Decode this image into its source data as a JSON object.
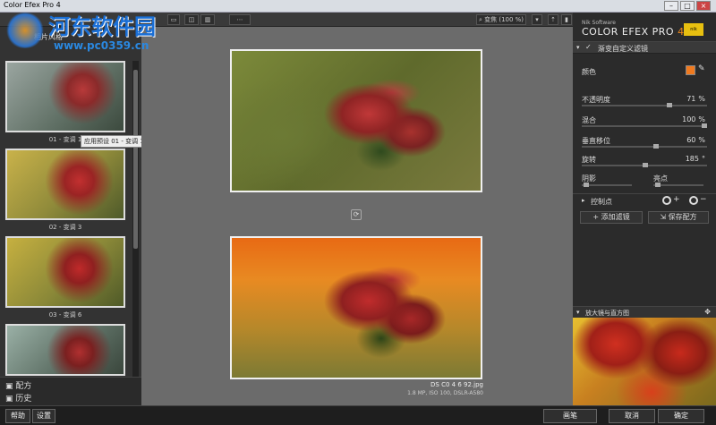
{
  "window": {
    "title": "Color Efex Pro 4"
  },
  "toolbar": {
    "zoom_label": "变焦 (100 %)"
  },
  "left": {
    "header": "相片风格",
    "presets": [
      {
        "label": "01 - 变调 1"
      },
      {
        "label": "02 - 变调 3"
      },
      {
        "label": "03 - 变调 6"
      },
      {
        "label": ""
      }
    ],
    "tooltip": "应用预设 01 - 变调 1",
    "recipes": "配方",
    "history": "历史"
  },
  "center": {
    "file_name": "DS C0 4 6 92.jpg",
    "file_info": "1.8 MP, ISO 100, DSLR-A580"
  },
  "right": {
    "brand_small": "Nik Software",
    "brand_big": "COLOR EFEX PRO",
    "brand_num": "4",
    "filter_name": "渐变自定义滤镜",
    "color_label": "颜色",
    "color_swatch": "#f07a1f",
    "rows": [
      {
        "label": "不透明度",
        "value": "71",
        "unit": "%",
        "level": 0.71
      },
      {
        "label": "混合",
        "value": "100",
        "unit": "%",
        "level": 1.0
      },
      {
        "label": "垂直移位",
        "value": "60",
        "unit": "%",
        "level": 0.6
      },
      {
        "label": "旋转",
        "value": "185",
        "unit": "°",
        "level": 0.51
      }
    ],
    "shadows_label": "阴影",
    "highlights_label": "亮点",
    "control_points_label": "控制点",
    "add_filter_label": "+ 添加滤镜",
    "save_recipe_label": "保存配方",
    "loupe_label": "放大镜与直方图"
  },
  "bottom": {
    "help_label": "帮助",
    "settings_label": "设置",
    "brush_label": "画笔",
    "cancel_label": "取消",
    "ok_label": "确定"
  },
  "watermark": {
    "text1": "河东软件园",
    "text2": "www.pc0359.cn"
  }
}
